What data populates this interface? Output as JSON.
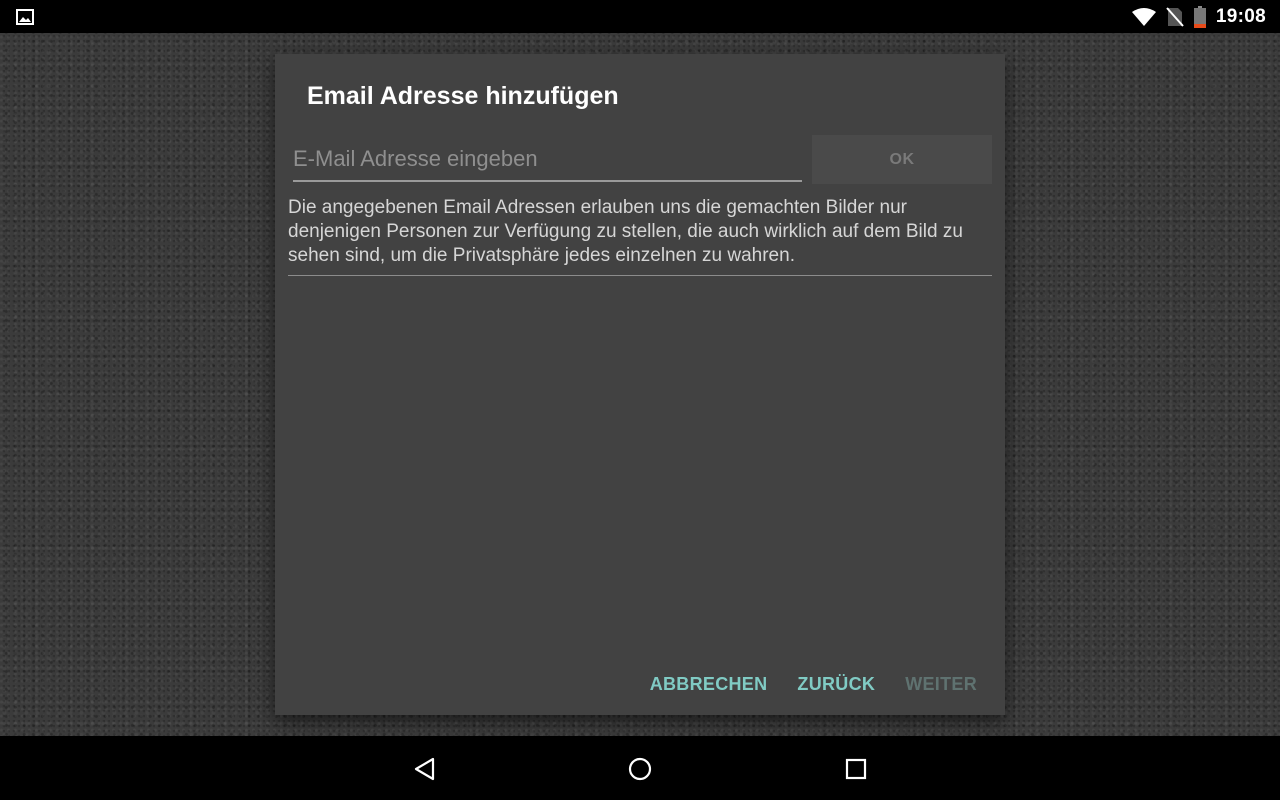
{
  "status_bar": {
    "time": "19:08",
    "icons": [
      "image-notification-icon",
      "wifi-icon",
      "no-sim-icon",
      "battery-low-icon"
    ]
  },
  "dialog": {
    "title": "Email Adresse hinzufügen",
    "email_input": {
      "value": "",
      "placeholder": "E-Mail Adresse eingeben"
    },
    "ok_label": "OK",
    "info_text": "Die angegebenen Email Adressen erlauben uns die gemachten Bilder nur denjenigen Personen zur Verfügung zu stellen, die auch wirklich auf dem Bild zu sehen sind, um die Privatsphäre jedes einzelnen zu wahren.",
    "email_list": [],
    "actions": {
      "cancel_label": "ABBRECHEN",
      "back_label": "ZURÜCK",
      "next_label": "WEITER"
    }
  },
  "colors": {
    "dialog_bg": "#424242",
    "accent": "#80cbc4",
    "accent_disabled": "#5f7270",
    "battery_low": "#e64a19"
  },
  "nav_bar": {
    "icons": [
      "back-icon",
      "home-icon",
      "recents-icon"
    ]
  }
}
